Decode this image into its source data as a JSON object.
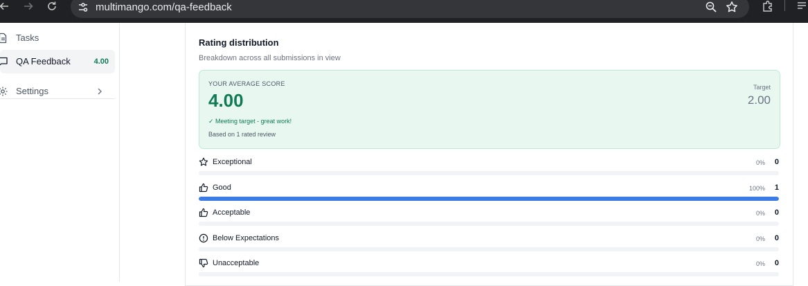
{
  "browser": {
    "url": "multimango.com/qa-feedback"
  },
  "sidebar": {
    "items": [
      {
        "label": "Tasks",
        "icon": "document-icon"
      },
      {
        "label": "QA Feedback",
        "icon": "chat-icon",
        "badge": "4.00",
        "active": true
      },
      {
        "label": "Settings",
        "icon": "gear-icon"
      }
    ]
  },
  "rating": {
    "title": "Rating distribution",
    "subtitle": "Breakdown across all submissions in view",
    "score": {
      "eyebrow": "YOUR AVERAGE SCORE",
      "value": "4.00",
      "target_label": "Target",
      "target_value": "2.00",
      "message": "✓ Meeting target - great work!",
      "basis": "Based on 1 rated review"
    },
    "rows": [
      {
        "label": "Exceptional",
        "pct_text": "0%",
        "count": "0",
        "fraction": 0,
        "icon": "star-icon"
      },
      {
        "label": "Good",
        "pct_text": "100%",
        "count": "1",
        "fraction": 1,
        "icon": "thumbs-up-icon"
      },
      {
        "label": "Acceptable",
        "pct_text": "0%",
        "count": "0",
        "fraction": 0,
        "icon": "thumbs-up-icon"
      },
      {
        "label": "Below Expectations",
        "pct_text": "0%",
        "count": "0",
        "fraction": 0,
        "icon": "alert-circle-icon"
      },
      {
        "label": "Unacceptable",
        "pct_text": "0%",
        "count": "0",
        "fraction": 0,
        "icon": "thumbs-down-icon"
      }
    ]
  },
  "colors": {
    "accent_green": "#0f7a55",
    "bar_blue": "#3b7be6",
    "score_bg": "#e8f8f1"
  }
}
